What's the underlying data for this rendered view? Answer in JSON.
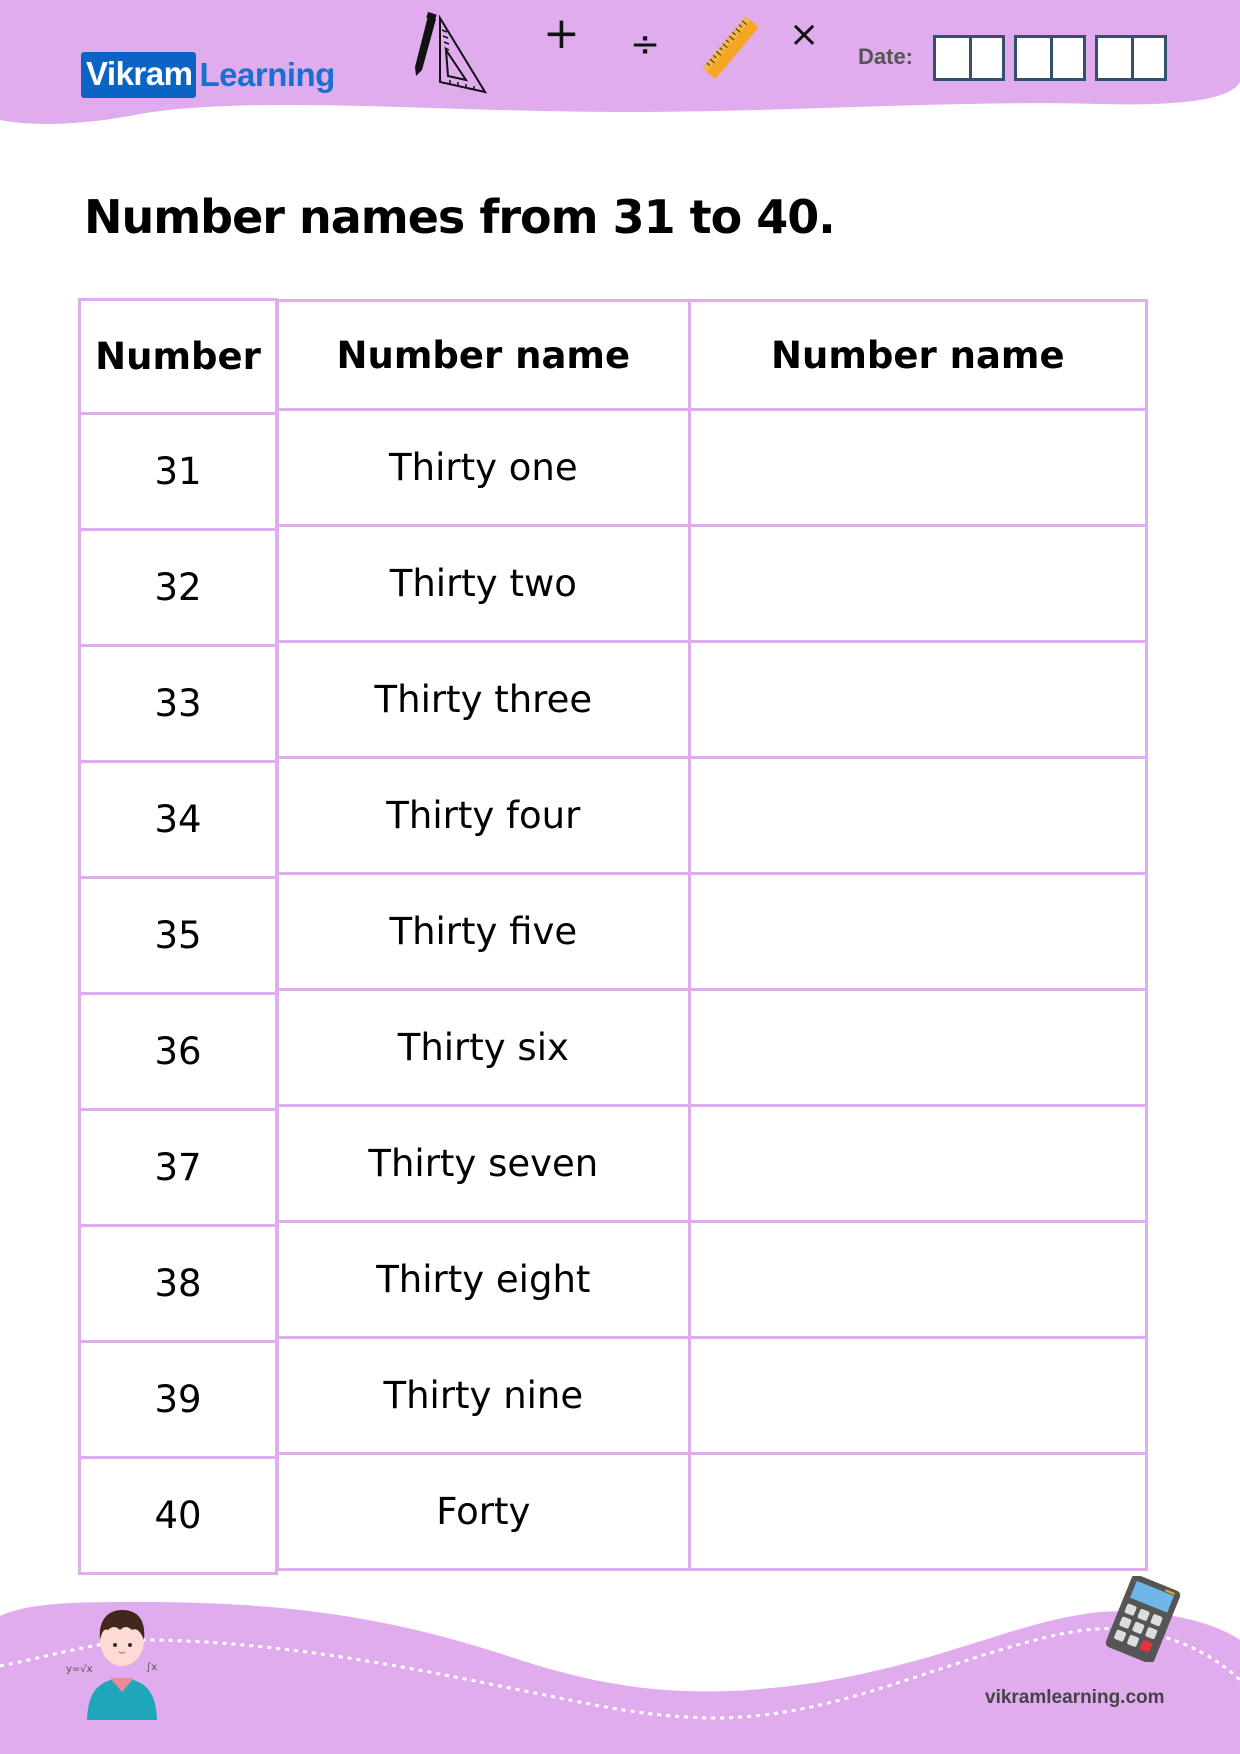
{
  "header": {
    "logo": {
      "part1": "Vikram",
      "part2": "Learning"
    },
    "math_symbols": {
      "plus": "+",
      "divide": "÷",
      "times": "×"
    },
    "date_label": "Date:",
    "colors": {
      "banner": "#e0acee",
      "logo_box": "#0b64c4",
      "logo_text": "#1a6fd0",
      "date_box_border": "#33506d"
    }
  },
  "title": "Number names from 31 to 40.",
  "table": {
    "headers": [
      "Number",
      "Number name",
      "Number name"
    ],
    "rows": [
      {
        "number": "31",
        "name": "Thirty one",
        "answer": ""
      },
      {
        "number": "32",
        "name": "Thirty two",
        "answer": ""
      },
      {
        "number": "33",
        "name": "Thirty three",
        "answer": ""
      },
      {
        "number": "34",
        "name": "Thirty four",
        "answer": ""
      },
      {
        "number": "35",
        "name": "Thirty five",
        "answer": ""
      },
      {
        "number": "36",
        "name": "Thirty six",
        "answer": ""
      },
      {
        "number": "37",
        "name": "Thirty seven",
        "answer": ""
      },
      {
        "number": "38",
        "name": "Thirty eight",
        "answer": ""
      },
      {
        "number": "39",
        "name": "Thirty nine",
        "answer": ""
      },
      {
        "number": "40",
        "name": "Forty",
        "answer": ""
      }
    ],
    "border_color": "#dfaded"
  },
  "footer": {
    "website": "vikramlearning.com"
  }
}
